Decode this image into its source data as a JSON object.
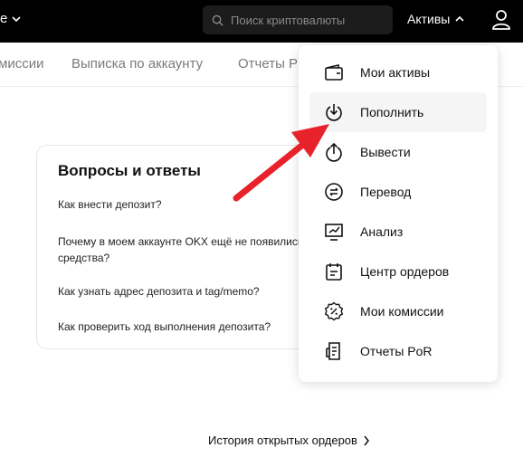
{
  "topbar": {
    "lang_fragment": "е",
    "search_placeholder": "Поиск криптовалюты",
    "assets_label": "Активы"
  },
  "subnav": [
    "миссии",
    "Выписка по аккаунту",
    "Отчеты Р"
  ],
  "faq": {
    "title": "Вопросы и ответы",
    "questions": [
      "Как внести депозит?",
      "Почему в моем аккаунте OKX ещё не появились средства?",
      "Как узнать адрес депозита и tag/memo?",
      "Как проверить ход выполнения депозита?"
    ]
  },
  "history_link": "История открытых ордеров",
  "dropdown": {
    "items": [
      {
        "label": "Мои активы",
        "icon": "wallet-icon"
      },
      {
        "label": "Пополнить",
        "icon": "deposit-icon"
      },
      {
        "label": "Вывести",
        "icon": "withdraw-icon"
      },
      {
        "label": "Перевод",
        "icon": "transfer-icon"
      },
      {
        "label": "Анализ",
        "icon": "analysis-icon"
      },
      {
        "label": "Центр ордеров",
        "icon": "order-center-icon"
      },
      {
        "label": "Мои комиссии",
        "icon": "fee-badge-icon"
      },
      {
        "label": "Отчеты PoR",
        "icon": "report-icon"
      }
    ]
  },
  "colors": {
    "topbar": "#000000",
    "annotation_arrow": "#e8222a"
  }
}
